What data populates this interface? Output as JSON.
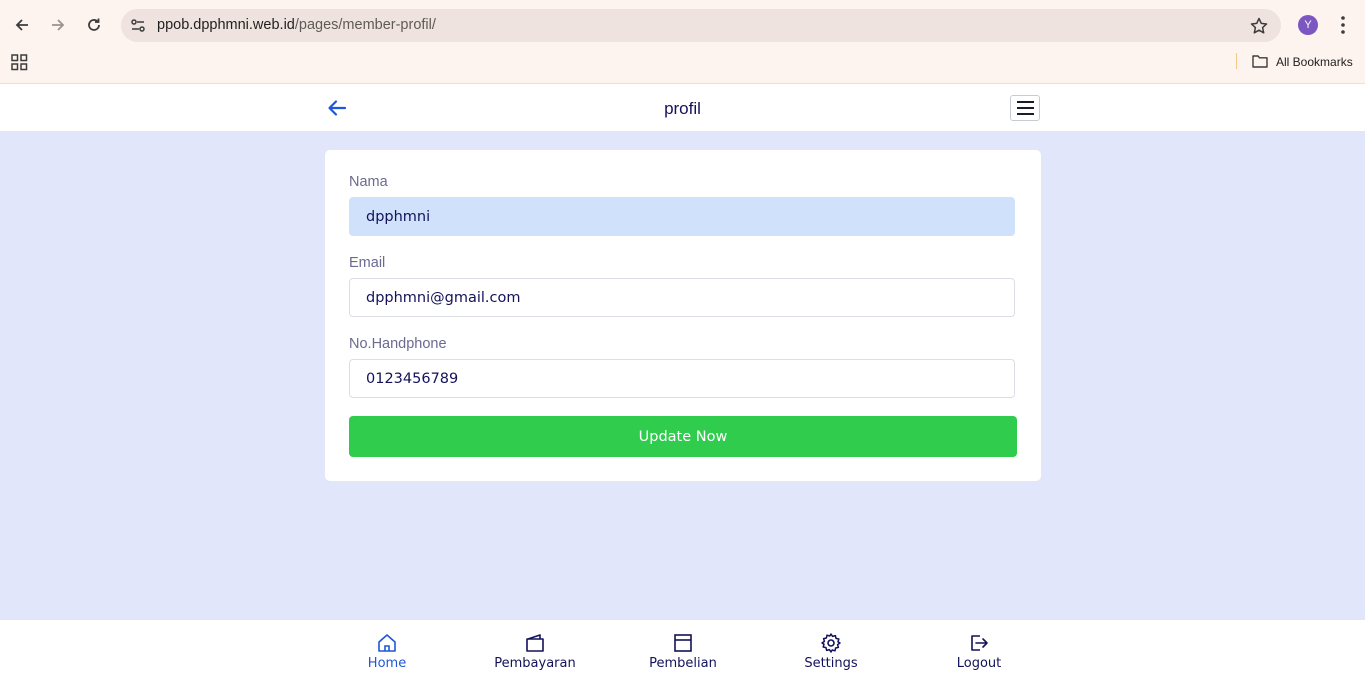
{
  "browser": {
    "url_host": "ppob.dpphmni.web.id",
    "url_path": "/pages/member-profil/",
    "profile_initial": "Y",
    "bookmarks_label": "All Bookmarks"
  },
  "header": {
    "title": "profil"
  },
  "form": {
    "fields": [
      {
        "label": "Nama",
        "value": "dpphmni"
      },
      {
        "label": "Email",
        "value": "dpphmni@gmail.com"
      },
      {
        "label": "No.Handphone",
        "value": "0123456789"
      }
    ],
    "submit_label": "Update Now"
  },
  "bottom_nav": {
    "items": [
      {
        "label": "Home",
        "icon": "home-icon",
        "active": true
      },
      {
        "label": "Pembayaran",
        "icon": "wallet-icon",
        "active": false
      },
      {
        "label": "Pembelian",
        "icon": "box-icon",
        "active": false
      },
      {
        "label": "Settings",
        "icon": "gear-icon",
        "active": false
      },
      {
        "label": "Logout",
        "icon": "logout-icon",
        "active": false
      }
    ]
  },
  "colors": {
    "page_bg": "#e1e6fb",
    "accent_green": "#30cc4e",
    "active_blue": "#1f57d6",
    "autofill_bg": "#cfe1fb",
    "title_navy": "#14125a"
  }
}
